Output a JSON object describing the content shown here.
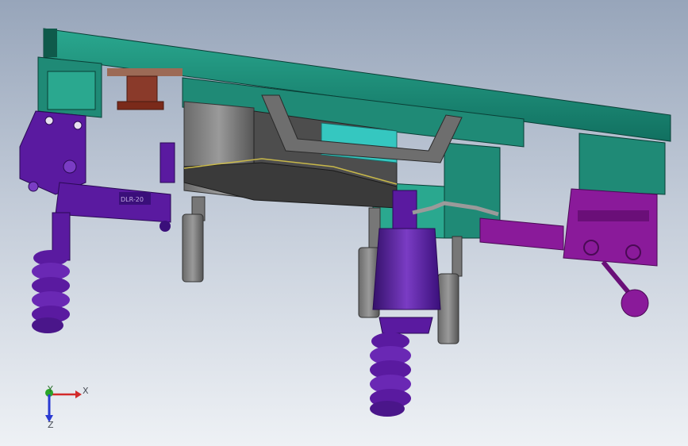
{
  "viewport": {
    "background_top": "#97a5ba",
    "background_bottom": "#eef1f5"
  },
  "model": {
    "colors": {
      "frame": "#1f8a76",
      "frame_dark": "#0f5a4b",
      "frame_light": "#2aa88f",
      "clamp": "#5a1aa0",
      "clamp_dark": "#34106a",
      "clamp_light": "#7a3cc4",
      "magenta": "#8a1a9a",
      "steel": "#8c8c8c",
      "steel_dark": "#4a4a4a",
      "copper": "#8a3a2a",
      "cyan": "#35c7c0"
    },
    "part_label": "DLR-20"
  },
  "triad": {
    "x_label": "X",
    "y_label": "Y",
    "z_label": "Z",
    "x_color": "#d22a2a",
    "y_color": "#2aa52a",
    "z_color": "#2a3ad2"
  }
}
